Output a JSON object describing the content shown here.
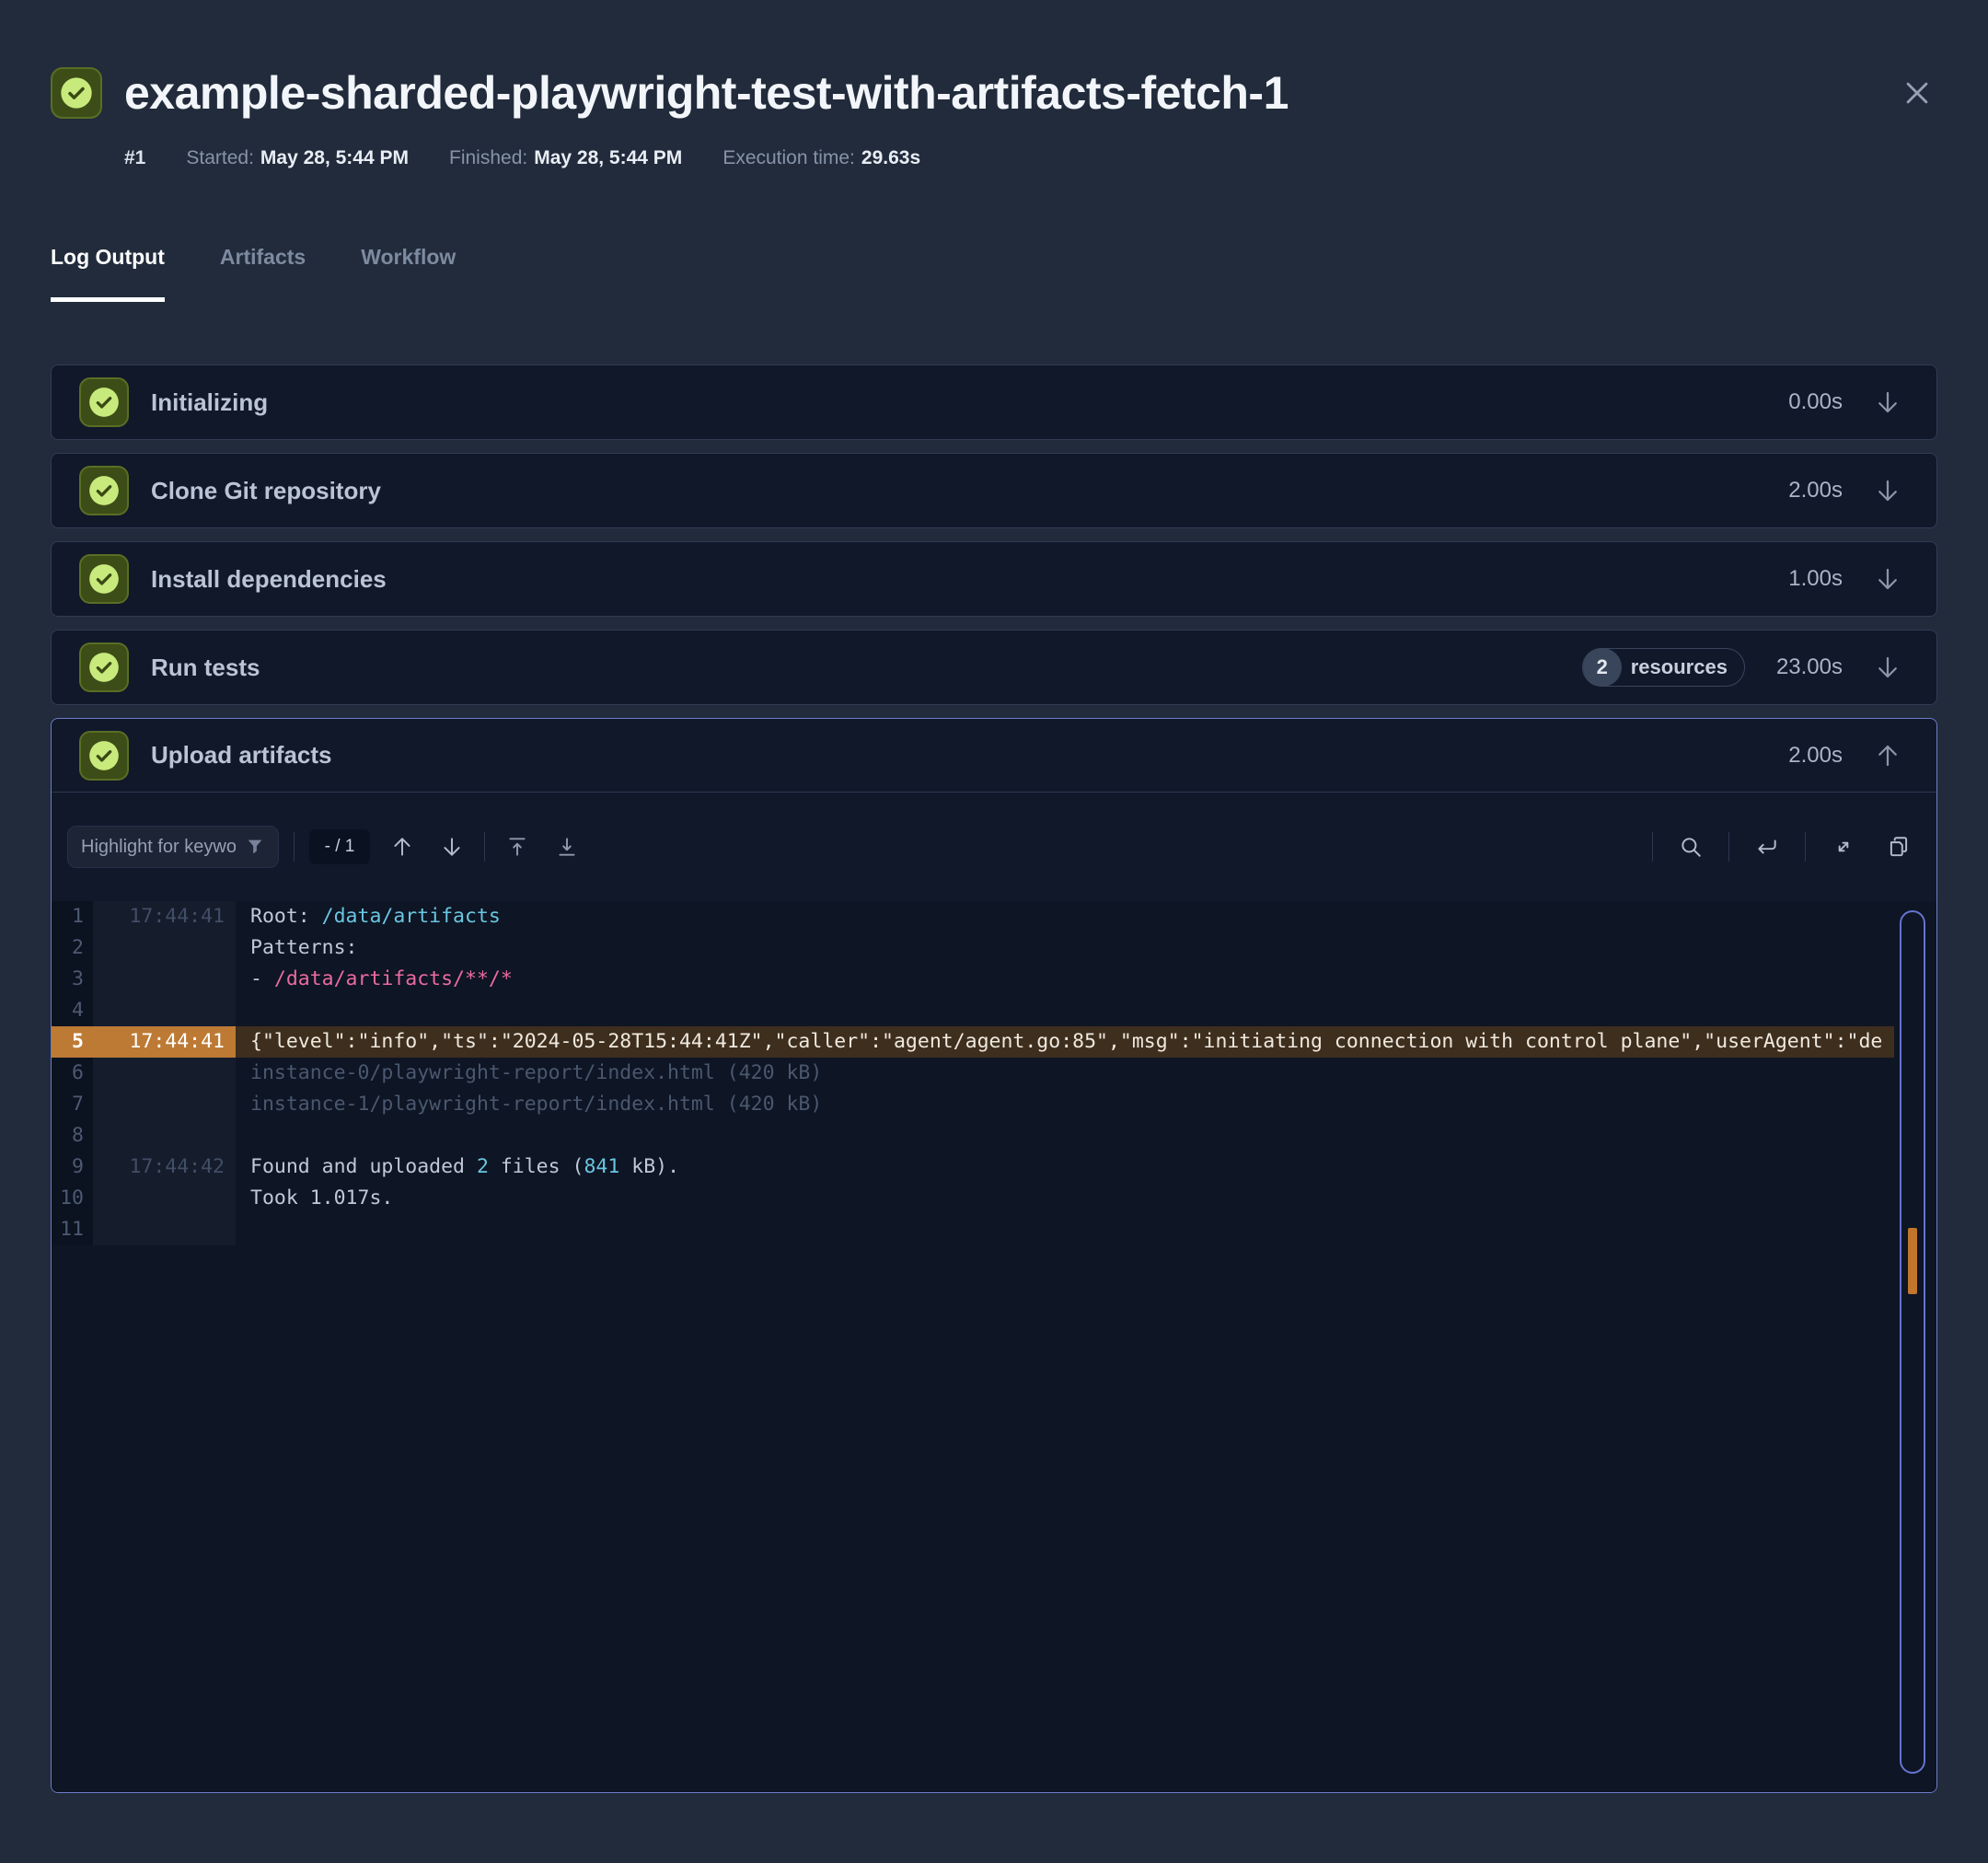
{
  "window": {
    "title": "example-sharded-playwright-test-with-artifacts-fetch-1"
  },
  "meta": {
    "run_number": "#1",
    "started_label": "Started:",
    "started_value": "May 28, 5:44 PM",
    "finished_label": "Finished:",
    "finished_value": "May 28, 5:44 PM",
    "execution_label": "Execution time:",
    "execution_value": "29.63s"
  },
  "tabs": [
    {
      "label": "Log Output",
      "active": true
    },
    {
      "label": "Artifacts",
      "active": false
    },
    {
      "label": "Workflow",
      "active": false
    }
  ],
  "steps": [
    {
      "label": "Initializing",
      "duration": "0.00s",
      "status": "success",
      "expanded": false
    },
    {
      "label": "Clone Git repository",
      "duration": "2.00s",
      "status": "success",
      "expanded": false
    },
    {
      "label": "Install dependencies",
      "duration": "1.00s",
      "status": "success",
      "expanded": false
    },
    {
      "label": "Run tests",
      "duration": "23.00s",
      "status": "success",
      "expanded": false,
      "badge": {
        "count": "2",
        "label": "resources"
      }
    },
    {
      "label": "Upload artifacts",
      "duration": "2.00s",
      "status": "success",
      "expanded": true
    }
  ],
  "toolbar": {
    "highlight_placeholder": "Highlight for keywords",
    "match_counter": "- / 1",
    "icons": [
      "filter-funnel",
      "arrow-up",
      "arrow-down",
      "scroll-to-top",
      "scroll-to-bottom",
      "search",
      "wrap-lines",
      "expand-fullscreen",
      "copy"
    ]
  },
  "log": {
    "lines": [
      {
        "no": "1",
        "time": "17:44:41",
        "highlight": false,
        "segments": [
          {
            "text": "Root: ",
            "color": "default"
          },
          {
            "text": "/data/artifacts",
            "color": "cyan"
          }
        ]
      },
      {
        "no": "2",
        "time": "",
        "highlight": false,
        "segments": [
          {
            "text": "Patterns:",
            "color": "default"
          }
        ]
      },
      {
        "no": "3",
        "time": "",
        "highlight": false,
        "segments": [
          {
            "text": "- ",
            "color": "default"
          },
          {
            "text": "/data/artifacts/**/*",
            "color": "pink"
          }
        ]
      },
      {
        "no": "4",
        "time": "",
        "highlight": false,
        "segments": []
      },
      {
        "no": "5",
        "time": "17:44:41",
        "highlight": true,
        "segments": [
          {
            "text": "{\"level\":\"info\",\"ts\":\"2024-05-28T15:44:41Z\",\"caller\":\"agent/agent.go:85\",\"msg\":\"initiating connection with control plane\",\"userAgent\":\"de",
            "color": "hl"
          }
        ]
      },
      {
        "no": "6",
        "time": "",
        "highlight": false,
        "segments": [
          {
            "text": "instance-0/playwright-report/index.html (420 kB)",
            "color": "dim"
          }
        ]
      },
      {
        "no": "7",
        "time": "",
        "highlight": false,
        "segments": [
          {
            "text": "instance-1/playwright-report/index.html (420 kB)",
            "color": "dim"
          }
        ]
      },
      {
        "no": "8",
        "time": "",
        "highlight": false,
        "segments": []
      },
      {
        "no": "9",
        "time": "17:44:42",
        "highlight": false,
        "segments": [
          {
            "text": "Found and uploaded ",
            "color": "default"
          },
          {
            "text": "2",
            "color": "cyan"
          },
          {
            "text": " files (",
            "color": "default"
          },
          {
            "text": "841",
            "color": "cyan"
          },
          {
            "text": " kB).",
            "color": "default"
          }
        ]
      },
      {
        "no": "10",
        "time": "",
        "highlight": false,
        "segments": [
          {
            "text": "Took 1.017s.",
            "color": "default"
          }
        ]
      },
      {
        "no": "11",
        "time": "",
        "highlight": false,
        "segments": []
      }
    ]
  },
  "colors": {
    "success_green_fill": "#c8ea7d",
    "success_green_bg": "#3d4d17",
    "highlight_row_gutter": "#bd7a35",
    "highlight_row_bg": "#3e2e1e",
    "log_cyan": "#6ac6e1",
    "log_pink": "#e96b9f",
    "scrollbar_track_accent": "#6573cf",
    "scrollbar_thumb_orange": "#c1762b",
    "expanded_panel_border": "#6e7cc8",
    "page_background": "#212b3b",
    "panel_background": "#10182a"
  }
}
